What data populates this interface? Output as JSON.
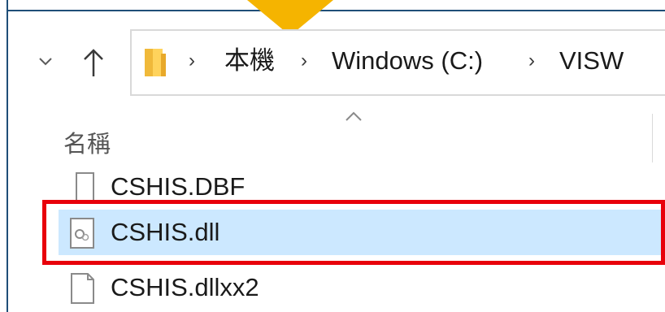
{
  "address_bar": {
    "crumbs": [
      "本機",
      "Windows (C:)",
      "VISW"
    ]
  },
  "file_list": {
    "column_header": "名稱",
    "files": [
      {
        "name": "CSHIS.DBF",
        "icon": "blank-file-icon",
        "selected": false
      },
      {
        "name": "CSHIS.dll",
        "icon": "dll-file-icon",
        "selected": true
      },
      {
        "name": "CSHIS.dllxx2",
        "icon": "blank-file-icon",
        "selected": false
      }
    ]
  },
  "colors": {
    "callout_arrow": "#f5b400",
    "highlight_border": "#e8000b",
    "selection_background": "#cce8ff",
    "window_border": "#1f4e78"
  }
}
